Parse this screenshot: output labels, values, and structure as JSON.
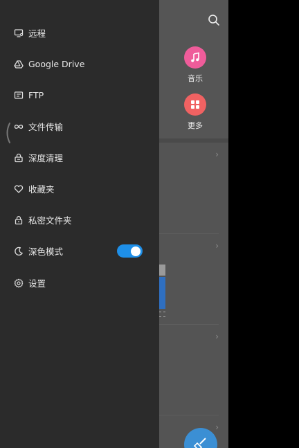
{
  "categories": [
    {
      "label": "音乐",
      "icon": "music-note-icon",
      "color": "#ef5c9a"
    },
    {
      "label": "更多",
      "icon": "grid-icon",
      "color": "#f06262"
    }
  ],
  "drawer": {
    "items": [
      {
        "label": "远程",
        "icon": "remote-monitor-icon"
      },
      {
        "label": "Google Drive",
        "icon": "google-drive-icon"
      },
      {
        "label": "FTP",
        "icon": "ftp-icon"
      },
      {
        "label": "文件传输",
        "icon": "infinity-link-icon"
      },
      {
        "label": "深度清理",
        "icon": "clean-lock-icon"
      },
      {
        "label": "收藏夹",
        "icon": "heart-icon"
      },
      {
        "label": "私密文件夹",
        "icon": "lock-icon"
      },
      {
        "label": "深色模式",
        "icon": "moon-icon"
      },
      {
        "label": "设置",
        "icon": "gear-icon"
      }
    ],
    "dark_mode_enabled": true
  },
  "colors": {
    "accent": "#1e8fe8",
    "drawer_bg": "#2b2b2b",
    "app_bg": "#545454"
  }
}
